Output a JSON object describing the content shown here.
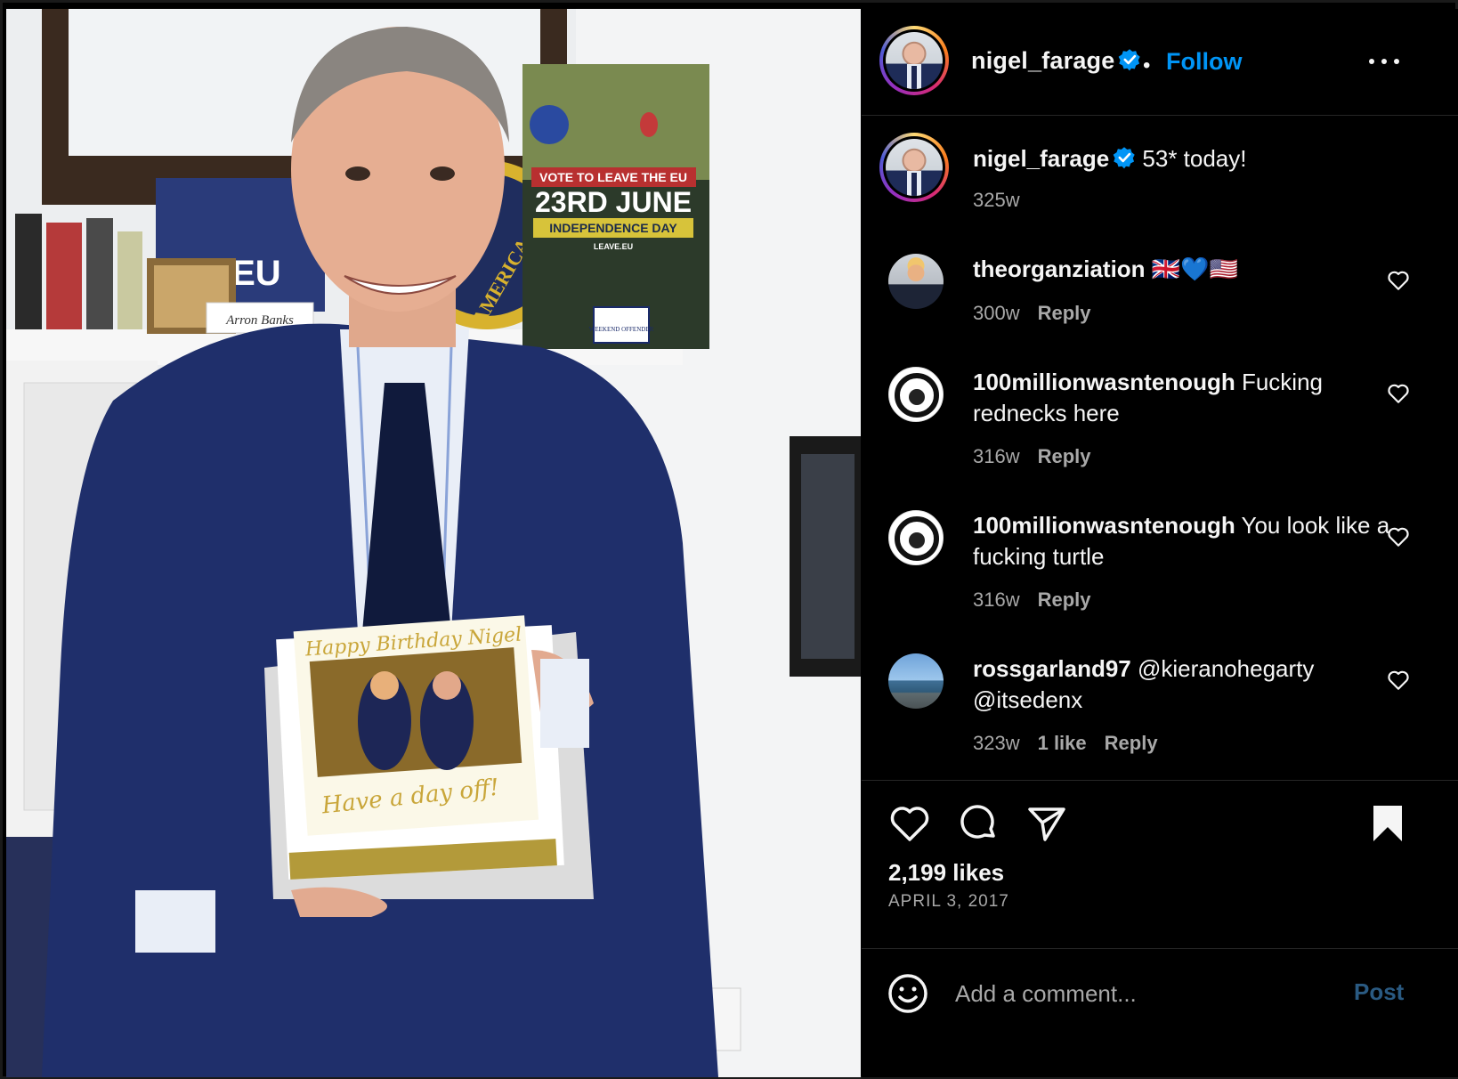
{
  "post": {
    "photo_texts": {
      "poster_line1": "VOTE TO LEAVE THE EU",
      "poster_line2": "23RD JUNE",
      "poster_line3": "INDEPENDENCE DAY",
      "poster_line4": "LEAVE.EU",
      "badge": "WEEKEND OFFENDER",
      "eu_sign": "E.EU",
      "nameplate": "Arron Banks",
      "seal": "AMERICA",
      "cake_top": "Happy Birthday Nigel",
      "cake_bottom": "Have a day off!"
    }
  },
  "header": {
    "username": "nigel_farage",
    "verified_icon": "verified-badge-icon",
    "separator": "•",
    "follow_label": "Follow",
    "more_icon": "more-options-icon"
  },
  "caption": {
    "username": "nigel_farage",
    "text": "53* today!",
    "time": "325w"
  },
  "comments": [
    {
      "username": "theorganziation",
      "text": "🇬🇧💙🇺🇸",
      "time": "300w",
      "likes": "",
      "reply": "Reply"
    },
    {
      "username": "100millionwasntenough",
      "text": "Fucking rednecks here",
      "time": "316w",
      "likes": "",
      "reply": "Reply"
    },
    {
      "username": "100millionwasntenough",
      "text": "You look like a fucking turtle",
      "time": "316w",
      "likes": "",
      "reply": "Reply"
    },
    {
      "username": "rossgarland97",
      "text": "@kieranohegarty @itsedenx",
      "time": "323w",
      "likes": "1 like",
      "reply": "Reply"
    }
  ],
  "actions": {
    "like_icon": "heart-icon",
    "comment_icon": "comment-bubble-icon",
    "share_icon": "paper-plane-icon",
    "save_icon": "bookmark-filled-icon",
    "likes_count": "2,199 likes",
    "date": "APRIL 3, 2017"
  },
  "add_comment": {
    "emoji_icon": "smiley-icon",
    "placeholder": "Add a comment...",
    "post_label": "Post"
  },
  "colors": {
    "background": "#000000",
    "link_blue": "#0095f6",
    "muted": "#a8a8a8",
    "post_disabled": "#2a5a82"
  }
}
